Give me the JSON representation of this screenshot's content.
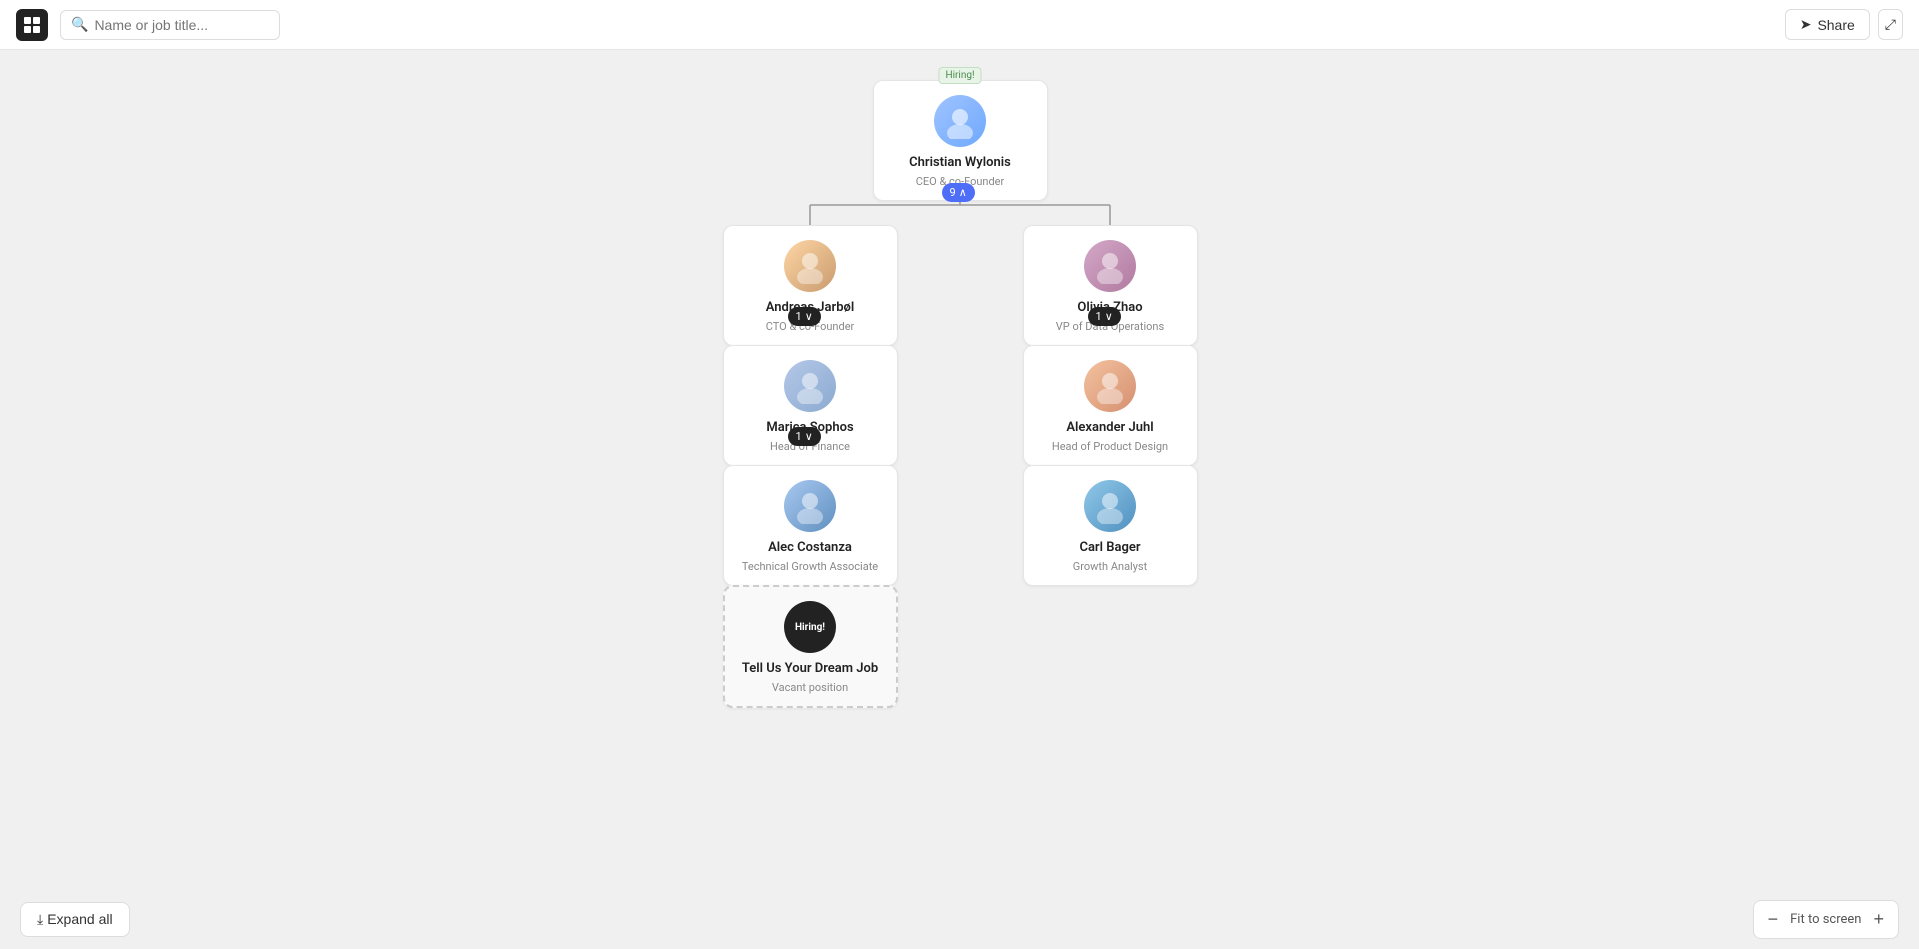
{
  "header": {
    "search_placeholder": "Name or job title...",
    "share_label": "Share",
    "fullscreen_icon": "⤢"
  },
  "nodes": {
    "christian": {
      "name": "Christian Wylonis",
      "title": "CEO & co-Founder",
      "hiring": true,
      "children_count": "9",
      "avatar_emoji": "👤"
    },
    "andreas": {
      "name": "Andreas Jarbøl",
      "title": "CTO & co-Founder",
      "children_count": "1",
      "avatar_emoji": "👤"
    },
    "olivia": {
      "name": "Olivia Zhao",
      "title": "VP of Data Operations",
      "children_count": "1",
      "avatar_emoji": "👤"
    },
    "marica": {
      "name": "Marica Sophos",
      "title": "Head of Finance",
      "children_count": "1",
      "avatar_emoji": "👤"
    },
    "alexander": {
      "name": "Alexander Juhl",
      "title": "Head of Product Design",
      "avatar_emoji": "👤"
    },
    "alec": {
      "name": "Alec Costanza",
      "title": "Technical Growth Associate",
      "avatar_emoji": "👤"
    },
    "carl": {
      "name": "Carl Bager",
      "title": "Growth Analyst",
      "avatar_emoji": "👤"
    },
    "vacant": {
      "name": "Tell Us Your Dream Job",
      "title": "Vacant position",
      "hiring": true
    }
  },
  "bottom_bar": {
    "expand_all_label": "Expand all",
    "fit_to_screen_label": "Fit to screen",
    "zoom_minus": "−",
    "zoom_plus": "+"
  }
}
